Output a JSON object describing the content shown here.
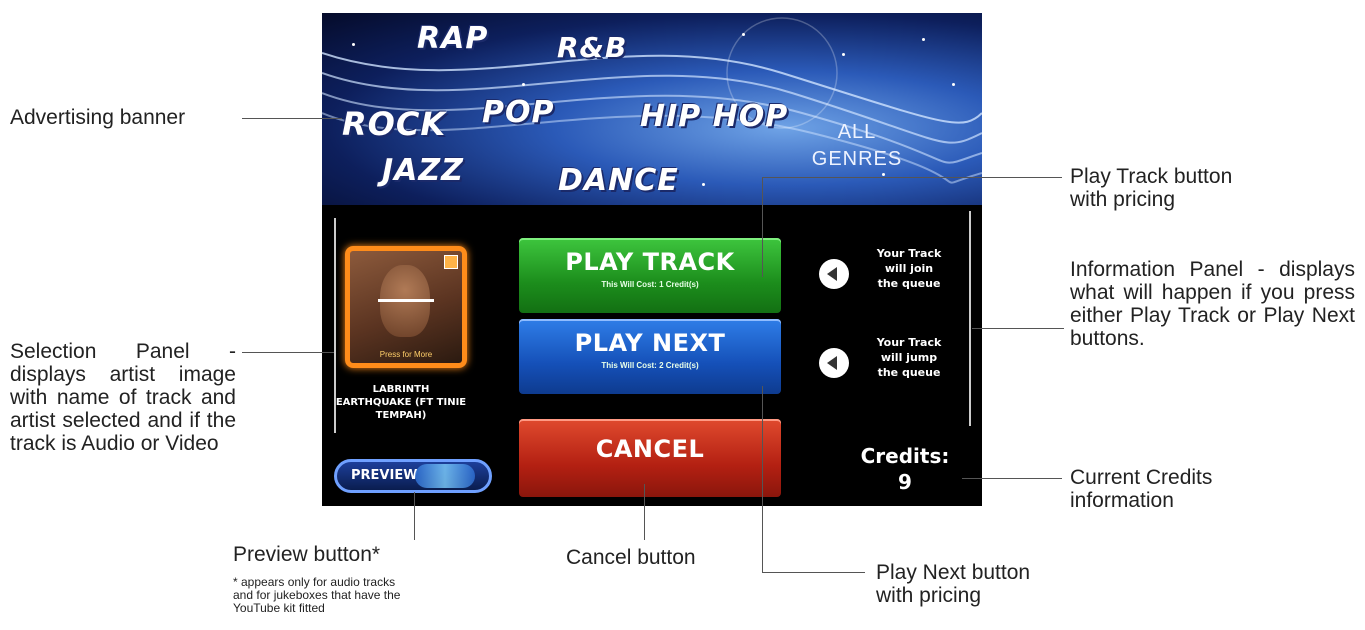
{
  "banner": {
    "genres": [
      "RAP",
      "R&B",
      "ROCK",
      "POP",
      "HIP HOP",
      "JAZZ",
      "DANCE"
    ],
    "all_genres_line1": "ALL",
    "all_genres_line2": "GENRES"
  },
  "selection": {
    "art_caption": "Press for More",
    "artist_line1": "LABRINTH",
    "artist_line2": "EARTHQUAKE (FT TINIE",
    "artist_line3": "TEMPAH)",
    "preview_label": "PREVIEW"
  },
  "buttons": {
    "play_track": "PLAY TRACK",
    "play_track_cost": "This Will Cost: 1 Credit(s)",
    "play_next": "PLAY NEXT",
    "play_next_cost": "This Will Cost: 2 Credit(s)",
    "cancel": "CANCEL"
  },
  "info": {
    "row1": [
      "Your Track",
      "will join",
      "the queue"
    ],
    "row2": [
      "Your Track",
      "will jump",
      "the queue"
    ]
  },
  "credits": {
    "label": "Credits:",
    "value": "9"
  },
  "annotations": {
    "advertising": "Advertising banner",
    "selection_panel": "Selection Panel - displays artist image with name of track and artist selected and if the track is Audio or Video",
    "preview_button": "Preview button*",
    "preview_note": "* appears only for audio tracks and for jukeboxes that have the YouTube kit fitted",
    "cancel_button": "Cancel button",
    "play_next_button": "Play Next button with pricing",
    "play_track_button": "Play Track button with pricing",
    "info_panel": "Information Panel - displays what will happen if you press either Play Track or Play Next buttons.",
    "current_credits": "Current Credits information"
  }
}
